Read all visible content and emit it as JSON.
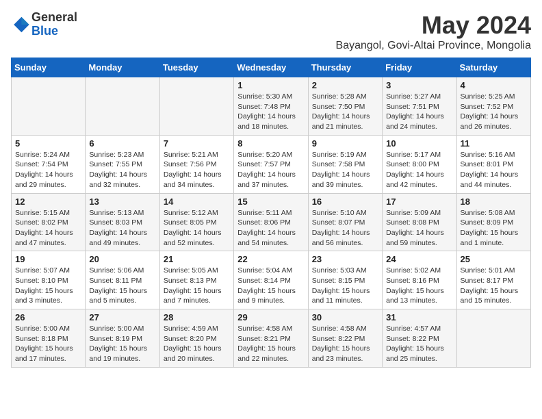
{
  "header": {
    "logo_general": "General",
    "logo_blue": "Blue",
    "main_title": "May 2024",
    "subtitle": "Bayangol, Govi-Altai Province, Mongolia"
  },
  "days_of_week": [
    "Sunday",
    "Monday",
    "Tuesday",
    "Wednesday",
    "Thursday",
    "Friday",
    "Saturday"
  ],
  "weeks": [
    [
      {
        "num": "",
        "info": ""
      },
      {
        "num": "",
        "info": ""
      },
      {
        "num": "",
        "info": ""
      },
      {
        "num": "1",
        "info": "Sunrise: 5:30 AM\nSunset: 7:48 PM\nDaylight: 14 hours\nand 18 minutes."
      },
      {
        "num": "2",
        "info": "Sunrise: 5:28 AM\nSunset: 7:50 PM\nDaylight: 14 hours\nand 21 minutes."
      },
      {
        "num": "3",
        "info": "Sunrise: 5:27 AM\nSunset: 7:51 PM\nDaylight: 14 hours\nand 24 minutes."
      },
      {
        "num": "4",
        "info": "Sunrise: 5:25 AM\nSunset: 7:52 PM\nDaylight: 14 hours\nand 26 minutes."
      }
    ],
    [
      {
        "num": "5",
        "info": "Sunrise: 5:24 AM\nSunset: 7:54 PM\nDaylight: 14 hours\nand 29 minutes."
      },
      {
        "num": "6",
        "info": "Sunrise: 5:23 AM\nSunset: 7:55 PM\nDaylight: 14 hours\nand 32 minutes."
      },
      {
        "num": "7",
        "info": "Sunrise: 5:21 AM\nSunset: 7:56 PM\nDaylight: 14 hours\nand 34 minutes."
      },
      {
        "num": "8",
        "info": "Sunrise: 5:20 AM\nSunset: 7:57 PM\nDaylight: 14 hours\nand 37 minutes."
      },
      {
        "num": "9",
        "info": "Sunrise: 5:19 AM\nSunset: 7:58 PM\nDaylight: 14 hours\nand 39 minutes."
      },
      {
        "num": "10",
        "info": "Sunrise: 5:17 AM\nSunset: 8:00 PM\nDaylight: 14 hours\nand 42 minutes."
      },
      {
        "num": "11",
        "info": "Sunrise: 5:16 AM\nSunset: 8:01 PM\nDaylight: 14 hours\nand 44 minutes."
      }
    ],
    [
      {
        "num": "12",
        "info": "Sunrise: 5:15 AM\nSunset: 8:02 PM\nDaylight: 14 hours\nand 47 minutes."
      },
      {
        "num": "13",
        "info": "Sunrise: 5:13 AM\nSunset: 8:03 PM\nDaylight: 14 hours\nand 49 minutes."
      },
      {
        "num": "14",
        "info": "Sunrise: 5:12 AM\nSunset: 8:05 PM\nDaylight: 14 hours\nand 52 minutes."
      },
      {
        "num": "15",
        "info": "Sunrise: 5:11 AM\nSunset: 8:06 PM\nDaylight: 14 hours\nand 54 minutes."
      },
      {
        "num": "16",
        "info": "Sunrise: 5:10 AM\nSunset: 8:07 PM\nDaylight: 14 hours\nand 56 minutes."
      },
      {
        "num": "17",
        "info": "Sunrise: 5:09 AM\nSunset: 8:08 PM\nDaylight: 14 hours\nand 59 minutes."
      },
      {
        "num": "18",
        "info": "Sunrise: 5:08 AM\nSunset: 8:09 PM\nDaylight: 15 hours\nand 1 minute."
      }
    ],
    [
      {
        "num": "19",
        "info": "Sunrise: 5:07 AM\nSunset: 8:10 PM\nDaylight: 15 hours\nand 3 minutes."
      },
      {
        "num": "20",
        "info": "Sunrise: 5:06 AM\nSunset: 8:11 PM\nDaylight: 15 hours\nand 5 minutes."
      },
      {
        "num": "21",
        "info": "Sunrise: 5:05 AM\nSunset: 8:13 PM\nDaylight: 15 hours\nand 7 minutes."
      },
      {
        "num": "22",
        "info": "Sunrise: 5:04 AM\nSunset: 8:14 PM\nDaylight: 15 hours\nand 9 minutes."
      },
      {
        "num": "23",
        "info": "Sunrise: 5:03 AM\nSunset: 8:15 PM\nDaylight: 15 hours\nand 11 minutes."
      },
      {
        "num": "24",
        "info": "Sunrise: 5:02 AM\nSunset: 8:16 PM\nDaylight: 15 hours\nand 13 minutes."
      },
      {
        "num": "25",
        "info": "Sunrise: 5:01 AM\nSunset: 8:17 PM\nDaylight: 15 hours\nand 15 minutes."
      }
    ],
    [
      {
        "num": "26",
        "info": "Sunrise: 5:00 AM\nSunset: 8:18 PM\nDaylight: 15 hours\nand 17 minutes."
      },
      {
        "num": "27",
        "info": "Sunrise: 5:00 AM\nSunset: 8:19 PM\nDaylight: 15 hours\nand 19 minutes."
      },
      {
        "num": "28",
        "info": "Sunrise: 4:59 AM\nSunset: 8:20 PM\nDaylight: 15 hours\nand 20 minutes."
      },
      {
        "num": "29",
        "info": "Sunrise: 4:58 AM\nSunset: 8:21 PM\nDaylight: 15 hours\nand 22 minutes."
      },
      {
        "num": "30",
        "info": "Sunrise: 4:58 AM\nSunset: 8:22 PM\nDaylight: 15 hours\nand 23 minutes."
      },
      {
        "num": "31",
        "info": "Sunrise: 4:57 AM\nSunset: 8:22 PM\nDaylight: 15 hours\nand 25 minutes."
      },
      {
        "num": "",
        "info": ""
      }
    ]
  ]
}
